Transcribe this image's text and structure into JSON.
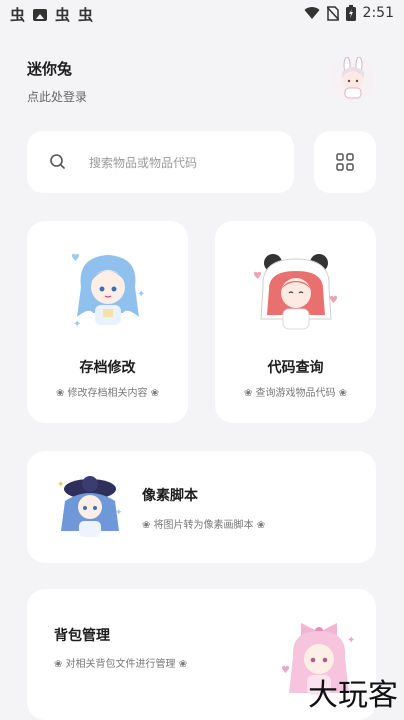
{
  "status_bar": {
    "notif_glyphs": [
      "虫",
      "虫",
      "虫"
    ],
    "time": "2:51"
  },
  "header": {
    "app_name": "迷你兔",
    "login_hint": "点此处登录"
  },
  "search": {
    "placeholder": "搜索物品或物品代码"
  },
  "cards": {
    "save_edit": {
      "title": "存档修改",
      "subtitle": "❀ 修改存档相关内容 ❀"
    },
    "code_lookup": {
      "title": "代码查询",
      "subtitle": "❀ 查询游戏物品代码 ❀"
    },
    "pixel_script": {
      "title": "像素脚本",
      "subtitle": "❀ 将图片转为像素画脚本 ❀"
    },
    "bag_manage": {
      "title": "背包管理",
      "subtitle": "❀ 对相关背包文件进行管理 ❀"
    }
  },
  "watermark": "大玩客",
  "colors": {
    "background": "#f4f4f6",
    "card": "#ffffff",
    "text_primary": "#1d1d1d",
    "text_secondary": "#777777"
  }
}
